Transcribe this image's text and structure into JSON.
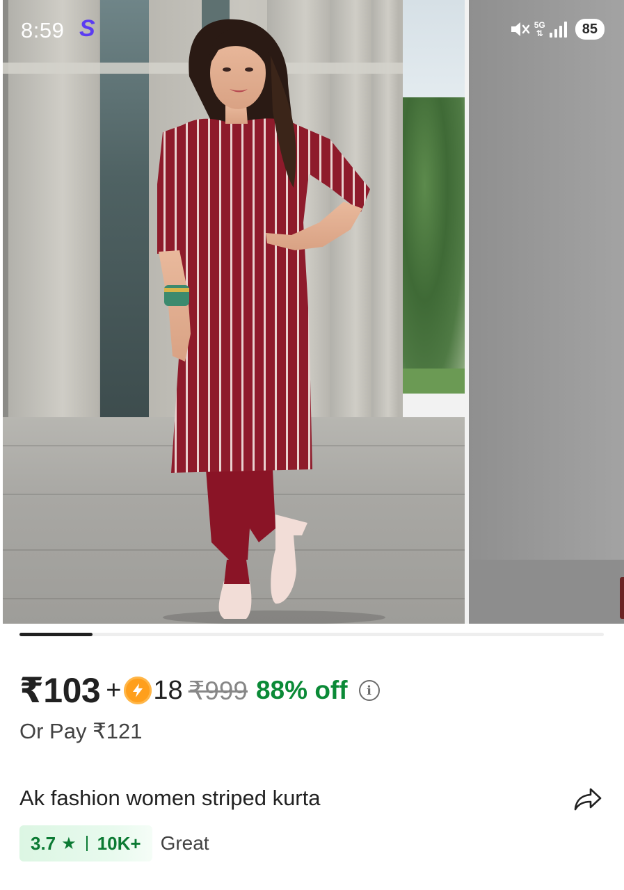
{
  "status_bar": {
    "time": "8:59",
    "app_icon_letter": "S",
    "network": "5G",
    "battery": "85"
  },
  "carousel": {
    "images": [
      "product-photo-woman-striped-kurta",
      "product-photo-2"
    ],
    "active_index": 0,
    "progress_fraction": 0.125
  },
  "price": {
    "selling": "₹103",
    "plus": "+",
    "coins": "18",
    "mrp": "₹999",
    "discount": "88% off",
    "or_pay": "Or Pay ₹121"
  },
  "product": {
    "title": "Ak fashion women striped kurta"
  },
  "rating": {
    "value": "3.7",
    "star": "★",
    "count": "10K+",
    "label": "Great"
  },
  "colors": {
    "discount_green": "#0b8a37",
    "rating_green": "#0b7a33",
    "coin_orange": "#ff9f1c",
    "kurta_maroon": "#8e1b2b"
  }
}
